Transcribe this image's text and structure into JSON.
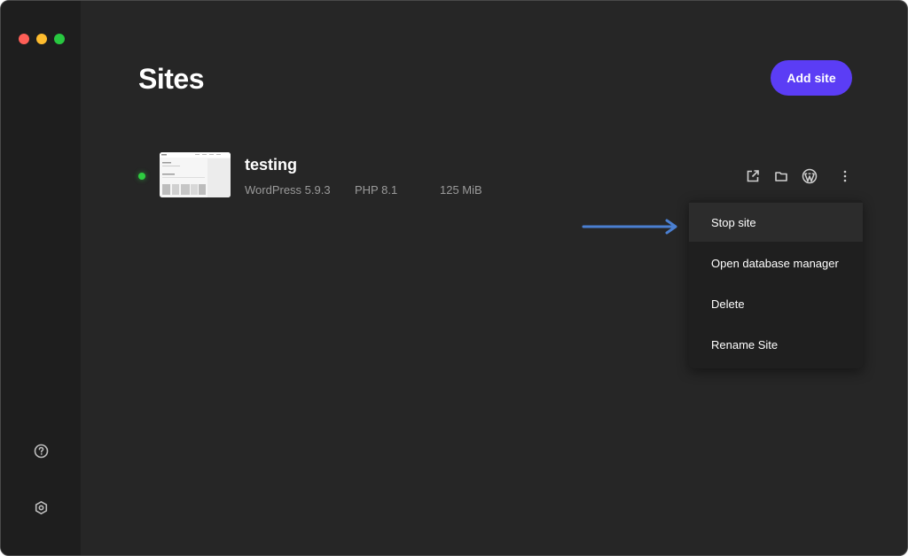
{
  "window": {
    "controls": {
      "close_color": "#ff5f57",
      "minimize_color": "#febc2e",
      "zoom_color": "#28c840"
    }
  },
  "sidebar": {
    "help_icon": "help-circle-icon",
    "settings_icon": "gear-icon"
  },
  "header": {
    "title": "Sites",
    "add_site_label": "Add site",
    "accent": "#5b3df5"
  },
  "sites": [
    {
      "name": "testing",
      "status": "running",
      "status_color": "#2ecc40",
      "wordpress_version": "WordPress 5.9.3",
      "php_version": "PHP 8.1",
      "size": "125 MiB",
      "actions": [
        "external-link-icon",
        "folder-icon",
        "wordpress-icon",
        "more-vertical-icon"
      ]
    }
  ],
  "context_menu": {
    "items": [
      {
        "label": "Stop site"
      },
      {
        "label": "Open database manager"
      },
      {
        "label": "Delete"
      },
      {
        "label": "Rename Site"
      }
    ]
  },
  "annotation": {
    "arrow_color": "#4a7fd1"
  }
}
